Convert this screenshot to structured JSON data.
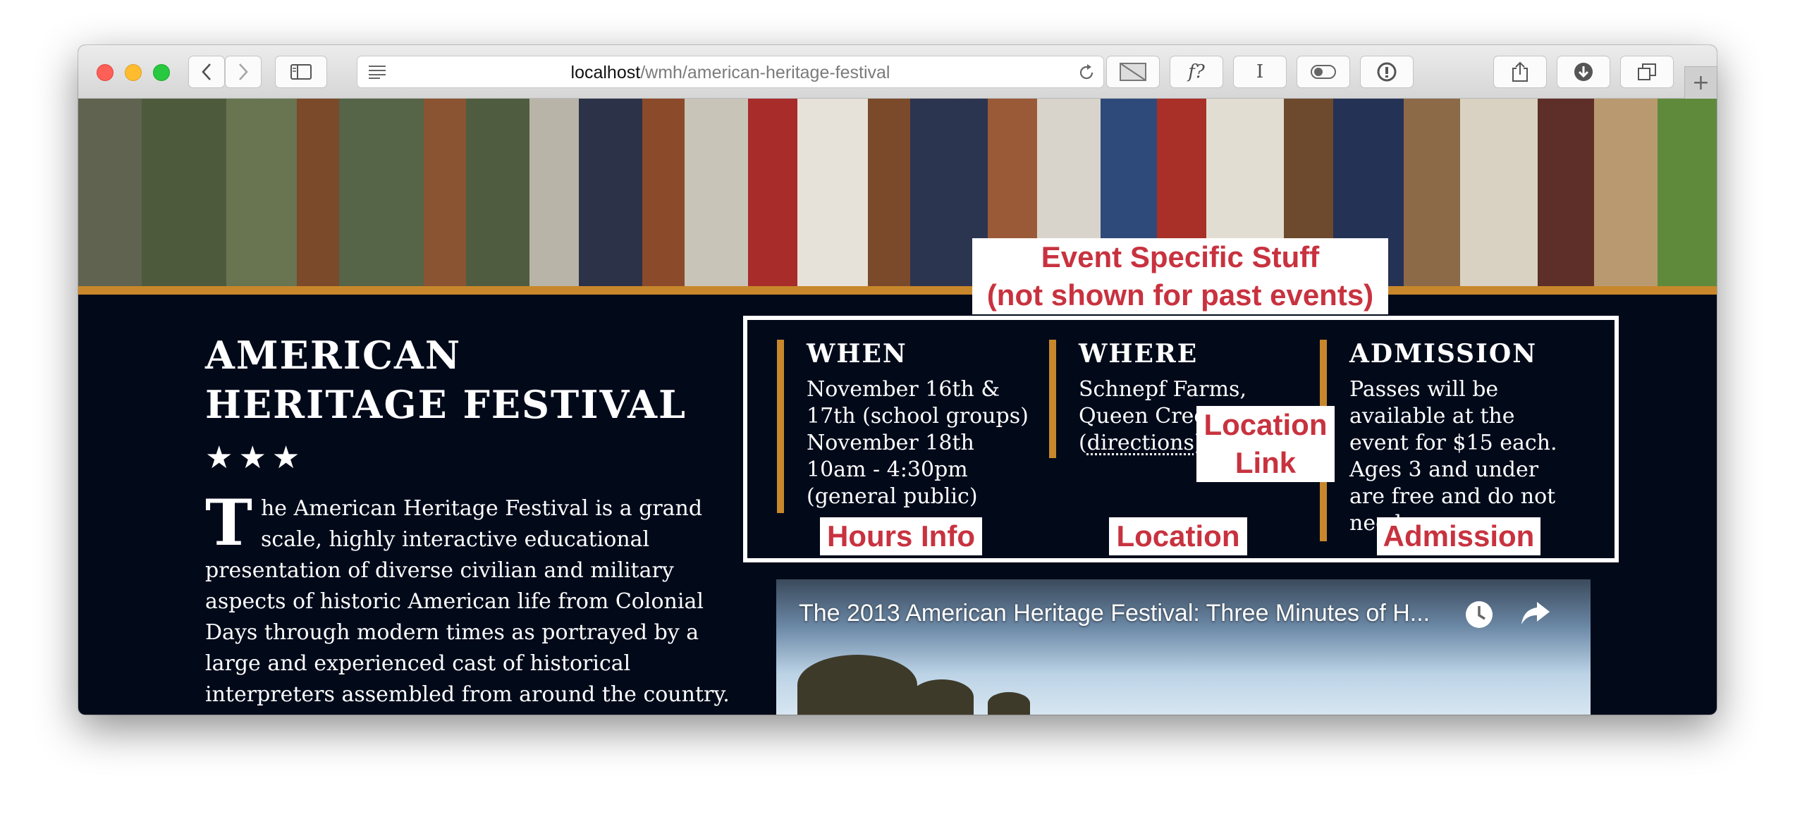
{
  "browser": {
    "url_host": "localhost",
    "url_path": "/wmh/american-heritage-festival",
    "toolbar_icons": [
      "back-icon",
      "forward-icon",
      "sidebar-icon",
      "reader-icon",
      "reload-icon",
      "image-icon",
      "font-icon",
      "cursor-icon",
      "toggle-icon",
      "info-icon",
      "share-icon",
      "download-icon",
      "tabs-icon"
    ],
    "extension_font_label": "f?",
    "extension_cursor_label": "I",
    "newtab_label": "+"
  },
  "page": {
    "title": "AMERICAN HERITAGE FESTIVAL",
    "stars": "★★★",
    "intro_dropcap": "T",
    "intro_text": "he American Heritage Festival is a grand scale, highly interactive educational presentation of diverse civilian and military aspects of historic American life from Colonial Days through modern times as portrayed by a large and experienced cast of historical interpreters assembled from around the country.",
    "when": {
      "heading": "WHEN",
      "text": "November 16th & 17th (school groups) November 18th 10am - 4:30pm (general public)"
    },
    "where": {
      "heading": "WHERE",
      "line1": "Schnepf Farms,",
      "line2": "Queen Creek",
      "directions_open": "(",
      "directions_link": "directions",
      "directions_close": ")"
    },
    "admission": {
      "heading": "ADMISSION",
      "text": "Passes will be available at the event for $15 each. Ages 3 and under are free and do not need a pass."
    },
    "video": {
      "title": "The 2013 American Heritage Festival: Three Minutes of H..."
    }
  },
  "annotations": {
    "event_specific_line1": "Event Specific Stuff",
    "event_specific_line2": "(not shown for past events)",
    "location_link_line1": "Location",
    "location_link_line2": "Link",
    "hours_info": "Hours Info",
    "location": "Location",
    "admission": "Admission"
  },
  "colors": {
    "page_background": "#020a1a",
    "accent_gold": "#c8872b",
    "annotation_red": "#c8323f",
    "text_white": "#ffffff"
  }
}
